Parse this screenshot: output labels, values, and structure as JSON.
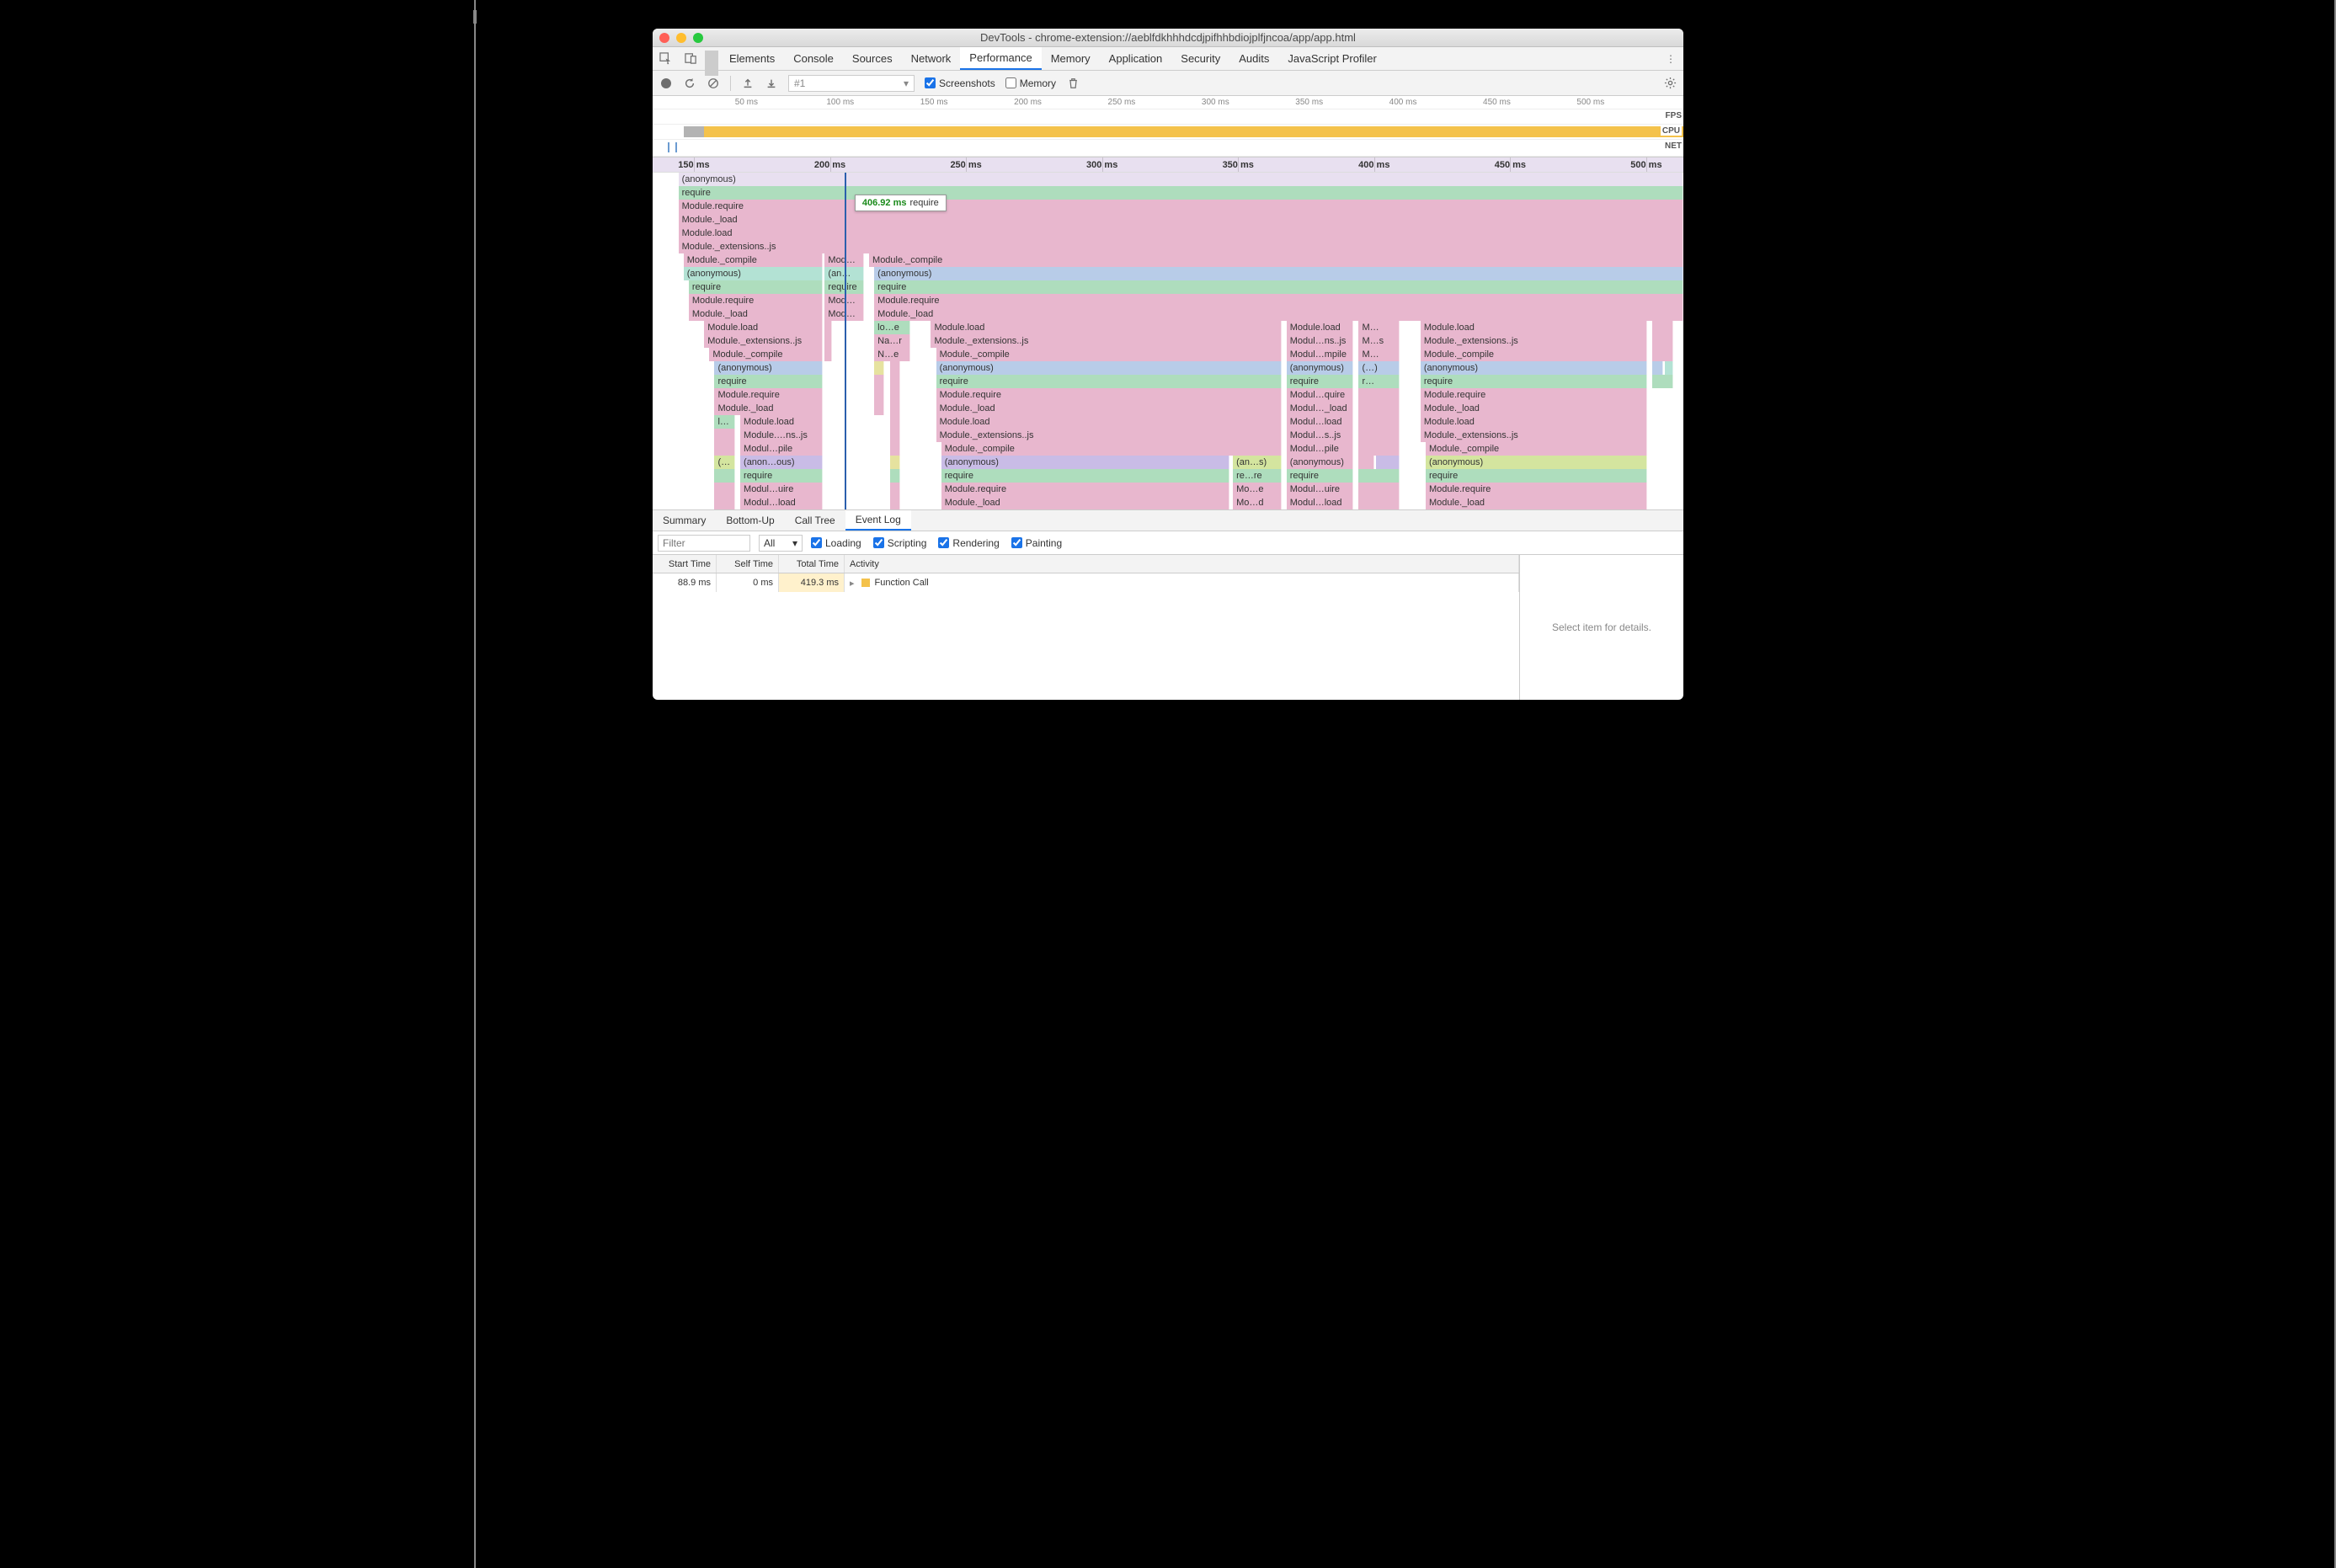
{
  "window": {
    "title": "DevTools - chrome-extension://aeblfdkhhhdcdjpifhhbdiojplfjncoa/app/app.html"
  },
  "tabs": [
    "Elements",
    "Console",
    "Sources",
    "Network",
    "Performance",
    "Memory",
    "Application",
    "Security",
    "Audits",
    "JavaScript Profiler"
  ],
  "active_tab": "Performance",
  "toolbar": {
    "recording_name": "#1",
    "screenshots_label": "Screenshots",
    "screenshots_checked": true,
    "memory_label": "Memory",
    "memory_checked": false
  },
  "overview": {
    "ticks": [
      "50 ms",
      "100 ms",
      "150 ms",
      "200 ms",
      "250 ms",
      "300 ms",
      "350 ms",
      "400 ms",
      "450 ms",
      "500 ms"
    ],
    "lanes": [
      "FPS",
      "CPU",
      "NET"
    ]
  },
  "flame": {
    "ticks": [
      "150 ms",
      "200 ms",
      "250 ms",
      "300 ms",
      "350 ms",
      "400 ms",
      "450 ms",
      "500 ms"
    ],
    "cursor_pct": 18.6,
    "tooltip": {
      "time": "406.92 ms",
      "label": "require"
    },
    "rows": [
      [
        {
          "l": "(anonymous)",
          "s": 2.5,
          "e": 100,
          "c": "c-lav"
        }
      ],
      [
        {
          "l": "require",
          "s": 2.5,
          "e": 100,
          "c": "c-green"
        }
      ],
      [
        {
          "l": "Module.require",
          "s": 2.5,
          "e": 100,
          "c": "c-pink"
        }
      ],
      [
        {
          "l": "Module._load",
          "s": 2.5,
          "e": 100,
          "c": "c-pink"
        }
      ],
      [
        {
          "l": "Module.load",
          "s": 2.5,
          "e": 100,
          "c": "c-pink"
        }
      ],
      [
        {
          "l": "Module._extensions..js",
          "s": 2.5,
          "e": 100,
          "c": "c-pink"
        }
      ],
      [
        {
          "l": "Module._compile",
          "s": 3,
          "e": 16.5,
          "c": "c-pink"
        },
        {
          "l": "Mod…ile",
          "s": 16.7,
          "e": 20.5,
          "c": "c-pink"
        },
        {
          "l": "Module._compile",
          "s": 21,
          "e": 100,
          "c": "c-pink"
        }
      ],
      [
        {
          "l": "(anonymous)",
          "s": 3,
          "e": 16.5,
          "c": "c-teal"
        },
        {
          "l": "(an…us)",
          "s": 16.7,
          "e": 20.5,
          "c": "c-teal"
        },
        {
          "l": "(anonymous)",
          "s": 21.5,
          "e": 100,
          "c": "c-blue"
        }
      ],
      [
        {
          "l": "require",
          "s": 3.5,
          "e": 16.5,
          "c": "c-green"
        },
        {
          "l": "require",
          "s": 16.7,
          "e": 20.5,
          "c": "c-green"
        },
        {
          "l": "require",
          "s": 21.5,
          "e": 100,
          "c": "c-green"
        }
      ],
      [
        {
          "l": "Module.require",
          "s": 3.5,
          "e": 16.5,
          "c": "c-pink"
        },
        {
          "l": "Mod…ire",
          "s": 16.7,
          "e": 20.5,
          "c": "c-pink"
        },
        {
          "l": "Module.require",
          "s": 21.5,
          "e": 100,
          "c": "c-pink"
        }
      ],
      [
        {
          "l": "Module._load",
          "s": 3.5,
          "e": 16.5,
          "c": "c-pink"
        },
        {
          "l": "Mod…ad",
          "s": 16.7,
          "e": 20.5,
          "c": "c-pink"
        },
        {
          "l": "Module._load",
          "s": 21.5,
          "e": 100,
          "c": "c-pink"
        }
      ],
      [
        {
          "l": "Module.load",
          "s": 5,
          "e": 16.5,
          "c": "c-pink"
        },
        {
          "l": "",
          "s": 16.7,
          "e": 17.2,
          "c": "c-pink"
        },
        {
          "l": "lo…e",
          "s": 21.5,
          "e": 25,
          "c": "c-green"
        },
        {
          "l": "Module.load",
          "s": 27,
          "e": 61,
          "c": "c-pink"
        },
        {
          "l": "Module.load",
          "s": 61.5,
          "e": 68,
          "c": "c-pink"
        },
        {
          "l": "M…",
          "s": 68.5,
          "e": 72.5,
          "c": "c-pink"
        },
        {
          "l": "Module.load",
          "s": 74.5,
          "e": 96.5,
          "c": "c-pink"
        },
        {
          "l": "",
          "s": 97,
          "e": 99,
          "c": "c-pink"
        }
      ],
      [
        {
          "l": "Module._extensions..js",
          "s": 5,
          "e": 16.5,
          "c": "c-pink"
        },
        {
          "l": "",
          "s": 16.7,
          "e": 17.2,
          "c": "c-pink"
        },
        {
          "l": "Na…r",
          "s": 21.5,
          "e": 25,
          "c": "c-pink"
        },
        {
          "l": "Module._extensions..js",
          "s": 27,
          "e": 61,
          "c": "c-pink"
        },
        {
          "l": "Modul…ns..js",
          "s": 61.5,
          "e": 68,
          "c": "c-pink"
        },
        {
          "l": "M…s",
          "s": 68.5,
          "e": 72.5,
          "c": "c-pink"
        },
        {
          "l": "Module._extensions..js",
          "s": 74.5,
          "e": 96.5,
          "c": "c-pink"
        },
        {
          "l": "",
          "s": 97,
          "e": 99,
          "c": "c-pink"
        }
      ],
      [
        {
          "l": "Module._compile",
          "s": 5.5,
          "e": 16.5,
          "c": "c-pink"
        },
        {
          "l": "",
          "s": 16.7,
          "e": 17.2,
          "c": "c-pink"
        },
        {
          "l": "N…e",
          "s": 21.5,
          "e": 25,
          "c": "c-pink"
        },
        {
          "l": "Module._compile",
          "s": 27.5,
          "e": 61,
          "c": "c-pink"
        },
        {
          "l": "Modul…mpile",
          "s": 61.5,
          "e": 68,
          "c": "c-pink"
        },
        {
          "l": "M…",
          "s": 68.5,
          "e": 72.5,
          "c": "c-pink"
        },
        {
          "l": "Module._compile",
          "s": 74.5,
          "e": 96.5,
          "c": "c-pink"
        },
        {
          "l": "",
          "s": 97,
          "e": 99,
          "c": "c-pink"
        }
      ],
      [
        {
          "l": "(anonymous)",
          "s": 6,
          "e": 16.5,
          "c": "c-blue"
        },
        {
          "l": "",
          "s": 21.5,
          "e": 22.5,
          "c": "c-yellow"
        },
        {
          "l": "",
          "s": 23,
          "e": 24,
          "c": "c-pink"
        },
        {
          "l": "(anonymous)",
          "s": 27.5,
          "e": 61,
          "c": "c-blue"
        },
        {
          "l": "(anonymous)",
          "s": 61.5,
          "e": 68,
          "c": "c-blue"
        },
        {
          "l": "(…)",
          "s": 68.5,
          "e": 72.5,
          "c": "c-blue"
        },
        {
          "l": "(anonymous)",
          "s": 74.5,
          "e": 96.5,
          "c": "c-blue"
        },
        {
          "l": "",
          "s": 97,
          "e": 98,
          "c": "c-blue"
        },
        {
          "l": "",
          "s": 98.2,
          "e": 99,
          "c": "c-teal"
        }
      ],
      [
        {
          "l": "require",
          "s": 6,
          "e": 16.5,
          "c": "c-green"
        },
        {
          "l": "",
          "s": 21.5,
          "e": 22.5,
          "c": "c-pink"
        },
        {
          "l": "",
          "s": 23,
          "e": 24,
          "c": "c-pink"
        },
        {
          "l": "require",
          "s": 27.5,
          "e": 61,
          "c": "c-green"
        },
        {
          "l": "require",
          "s": 61.5,
          "e": 68,
          "c": "c-green"
        },
        {
          "l": "r…",
          "s": 68.5,
          "e": 72.5,
          "c": "c-green"
        },
        {
          "l": "require",
          "s": 74.5,
          "e": 96.5,
          "c": "c-green"
        },
        {
          "l": "",
          "s": 97,
          "e": 99,
          "c": "c-green"
        }
      ],
      [
        {
          "l": "Module.require",
          "s": 6,
          "e": 16.5,
          "c": "c-pink"
        },
        {
          "l": "",
          "s": 21.5,
          "e": 22.5,
          "c": "c-pink"
        },
        {
          "l": "",
          "s": 23,
          "e": 24,
          "c": "c-pink"
        },
        {
          "l": "Module.require",
          "s": 27.5,
          "e": 61,
          "c": "c-pink"
        },
        {
          "l": "Modul…quire",
          "s": 61.5,
          "e": 68,
          "c": "c-pink"
        },
        {
          "l": "",
          "s": 68.5,
          "e": 72.5,
          "c": "c-pink"
        },
        {
          "l": "Module.require",
          "s": 74.5,
          "e": 96.5,
          "c": "c-pink"
        }
      ],
      [
        {
          "l": "Module._load",
          "s": 6,
          "e": 16.5,
          "c": "c-pink"
        },
        {
          "l": "",
          "s": 21.5,
          "e": 22.5,
          "c": "c-pink"
        },
        {
          "l": "",
          "s": 23,
          "e": 24,
          "c": "c-pink"
        },
        {
          "l": "Module._load",
          "s": 27.5,
          "e": 61,
          "c": "c-pink"
        },
        {
          "l": "Modul…_load",
          "s": 61.5,
          "e": 68,
          "c": "c-pink"
        },
        {
          "l": "",
          "s": 68.5,
          "e": 72.5,
          "c": "c-pink"
        },
        {
          "l": "Module._load",
          "s": 74.5,
          "e": 96.5,
          "c": "c-pink"
        }
      ],
      [
        {
          "l": "l…",
          "s": 6,
          "e": 8,
          "c": "c-green"
        },
        {
          "l": "Module.load",
          "s": 8.5,
          "e": 16.5,
          "c": "c-pink"
        },
        {
          "l": "",
          "s": 23,
          "e": 24,
          "c": "c-pink"
        },
        {
          "l": "Module.load",
          "s": 27.5,
          "e": 61,
          "c": "c-pink"
        },
        {
          "l": "Modul…load",
          "s": 61.5,
          "e": 68,
          "c": "c-pink"
        },
        {
          "l": "",
          "s": 68.5,
          "e": 72.5,
          "c": "c-pink"
        },
        {
          "l": "Module.load",
          "s": 74.5,
          "e": 96.5,
          "c": "c-pink"
        }
      ],
      [
        {
          "l": "",
          "s": 6,
          "e": 8,
          "c": "c-pink"
        },
        {
          "l": "Module.…ns..js",
          "s": 8.5,
          "e": 16.5,
          "c": "c-pink"
        },
        {
          "l": "",
          "s": 23,
          "e": 24,
          "c": "c-pink"
        },
        {
          "l": "Module._extensions..js",
          "s": 27.5,
          "e": 61,
          "c": "c-pink"
        },
        {
          "l": "Modul…s..js",
          "s": 61.5,
          "e": 68,
          "c": "c-pink"
        },
        {
          "l": "",
          "s": 68.5,
          "e": 72.5,
          "c": "c-pink"
        },
        {
          "l": "Module._extensions..js",
          "s": 74.5,
          "e": 96.5,
          "c": "c-pink"
        }
      ],
      [
        {
          "l": "",
          "s": 6,
          "e": 8,
          "c": "c-pink"
        },
        {
          "l": "Modul…pile",
          "s": 8.5,
          "e": 16.5,
          "c": "c-pink"
        },
        {
          "l": "",
          "s": 23,
          "e": 24,
          "c": "c-pink"
        },
        {
          "l": "Module._compile",
          "s": 28,
          "e": 61,
          "c": "c-pink"
        },
        {
          "l": "Modul…pile",
          "s": 61.5,
          "e": 68,
          "c": "c-pink"
        },
        {
          "l": "",
          "s": 68.5,
          "e": 72.5,
          "c": "c-pink"
        },
        {
          "l": "Module._compile",
          "s": 75,
          "e": 96.5,
          "c": "c-pink"
        }
      ],
      [
        {
          "l": "(…",
          "s": 6,
          "e": 8,
          "c": "c-ygreen"
        },
        {
          "l": "(anon…ous)",
          "s": 8.5,
          "e": 16.5,
          "c": "c-purple"
        },
        {
          "l": "",
          "s": 23,
          "e": 24,
          "c": "c-yellow"
        },
        {
          "l": "(anonymous)",
          "s": 28,
          "e": 56,
          "c": "c-purple"
        },
        {
          "l": "(an…s)",
          "s": 56.3,
          "e": 61,
          "c": "c-ygreen"
        },
        {
          "l": "(anonymous)",
          "s": 61.5,
          "e": 68,
          "c": "c-pink"
        },
        {
          "l": "",
          "s": 68.5,
          "e": 70,
          "c": "c-pink"
        },
        {
          "l": "",
          "s": 70.2,
          "e": 72.5,
          "c": "c-purple"
        },
        {
          "l": "(anonymous)",
          "s": 75,
          "e": 96.5,
          "c": "c-ygreen"
        }
      ],
      [
        {
          "l": "",
          "s": 6,
          "e": 8,
          "c": "c-green"
        },
        {
          "l": "require",
          "s": 8.5,
          "e": 16.5,
          "c": "c-green"
        },
        {
          "l": "",
          "s": 23,
          "e": 24,
          "c": "c-green"
        },
        {
          "l": "require",
          "s": 28,
          "e": 56,
          "c": "c-green"
        },
        {
          "l": "re…re",
          "s": 56.3,
          "e": 61,
          "c": "c-green"
        },
        {
          "l": "require",
          "s": 61.5,
          "e": 68,
          "c": "c-green"
        },
        {
          "l": "",
          "s": 68.5,
          "e": 72.5,
          "c": "c-green"
        },
        {
          "l": "require",
          "s": 75,
          "e": 96.5,
          "c": "c-green"
        }
      ],
      [
        {
          "l": "",
          "s": 6,
          "e": 8,
          "c": "c-pink"
        },
        {
          "l": "Modul…uire",
          "s": 8.5,
          "e": 16.5,
          "c": "c-pink"
        },
        {
          "l": "",
          "s": 23,
          "e": 24,
          "c": "c-pink"
        },
        {
          "l": "Module.require",
          "s": 28,
          "e": 56,
          "c": "c-pink"
        },
        {
          "l": "Mo…e",
          "s": 56.3,
          "e": 61,
          "c": "c-pink"
        },
        {
          "l": "Modul…uire",
          "s": 61.5,
          "e": 68,
          "c": "c-pink"
        },
        {
          "l": "",
          "s": 68.5,
          "e": 72.5,
          "c": "c-pink"
        },
        {
          "l": "Module.require",
          "s": 75,
          "e": 96.5,
          "c": "c-pink"
        }
      ],
      [
        {
          "l": "",
          "s": 6,
          "e": 8,
          "c": "c-pink"
        },
        {
          "l": "Modul…load",
          "s": 8.5,
          "e": 16.5,
          "c": "c-pink"
        },
        {
          "l": "",
          "s": 23,
          "e": 24,
          "c": "c-pink"
        },
        {
          "l": "Module._load",
          "s": 28,
          "e": 56,
          "c": "c-pink"
        },
        {
          "l": "Mo…d",
          "s": 56.3,
          "e": 61,
          "c": "c-pink"
        },
        {
          "l": "Modul…load",
          "s": 61.5,
          "e": 68,
          "c": "c-pink"
        },
        {
          "l": "",
          "s": 68.5,
          "e": 72.5,
          "c": "c-pink"
        },
        {
          "l": "Module._load",
          "s": 75,
          "e": 96.5,
          "c": "c-pink"
        }
      ]
    ]
  },
  "bottom_tabs": [
    "Summary",
    "Bottom-Up",
    "Call Tree",
    "Event Log"
  ],
  "active_bottom_tab": "Event Log",
  "filter": {
    "placeholder": "Filter",
    "level": "All",
    "checks": [
      {
        "label": "Loading",
        "checked": true
      },
      {
        "label": "Scripting",
        "checked": true
      },
      {
        "label": "Rendering",
        "checked": true
      },
      {
        "label": "Painting",
        "checked": true
      }
    ]
  },
  "event_log": {
    "headers": [
      "Start Time",
      "Self Time",
      "Total Time",
      "Activity"
    ],
    "rows": [
      {
        "start": "88.9 ms",
        "self": "0 ms",
        "total": "419.3 ms",
        "activity": "Function Call"
      }
    ]
  },
  "detail_placeholder": "Select item for details."
}
